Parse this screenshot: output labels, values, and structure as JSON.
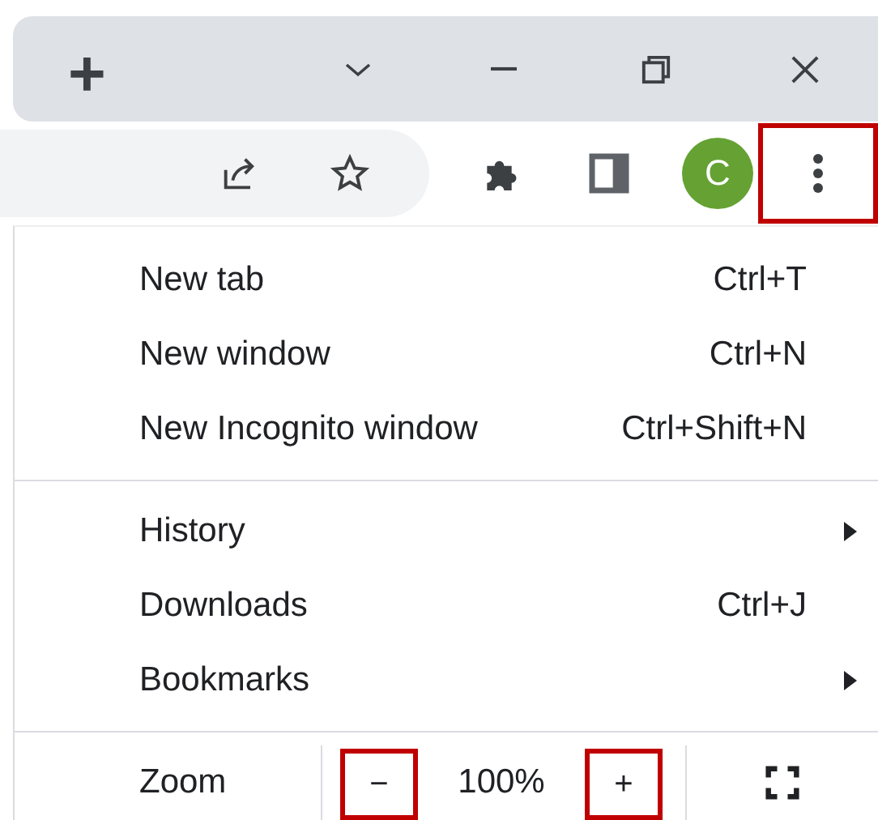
{
  "tab_bar": {
    "new_tab": "+"
  },
  "toolbar": {
    "avatar": "C",
    "menu_button": {
      "highlighted": true
    }
  },
  "menu": {
    "sections": [
      [
        {
          "kind": "item",
          "label": "New tab",
          "shortcut": "Ctrl+T"
        },
        {
          "kind": "item",
          "label": "New window",
          "shortcut": "Ctrl+N"
        },
        {
          "kind": "item",
          "label": "New Incognito window",
          "shortcut": "Ctrl+Shift+N"
        }
      ],
      [
        {
          "kind": "submenu",
          "label": "History"
        },
        {
          "kind": "item",
          "label": "Downloads",
          "shortcut": "Ctrl+J"
        },
        {
          "kind": "submenu",
          "label": "Bookmarks"
        }
      ]
    ],
    "zoom": {
      "label": "Zoom",
      "minus": {
        "text": "−",
        "highlighted": true
      },
      "value": "100%",
      "plus": {
        "text": "+",
        "highlighted": true
      }
    }
  }
}
